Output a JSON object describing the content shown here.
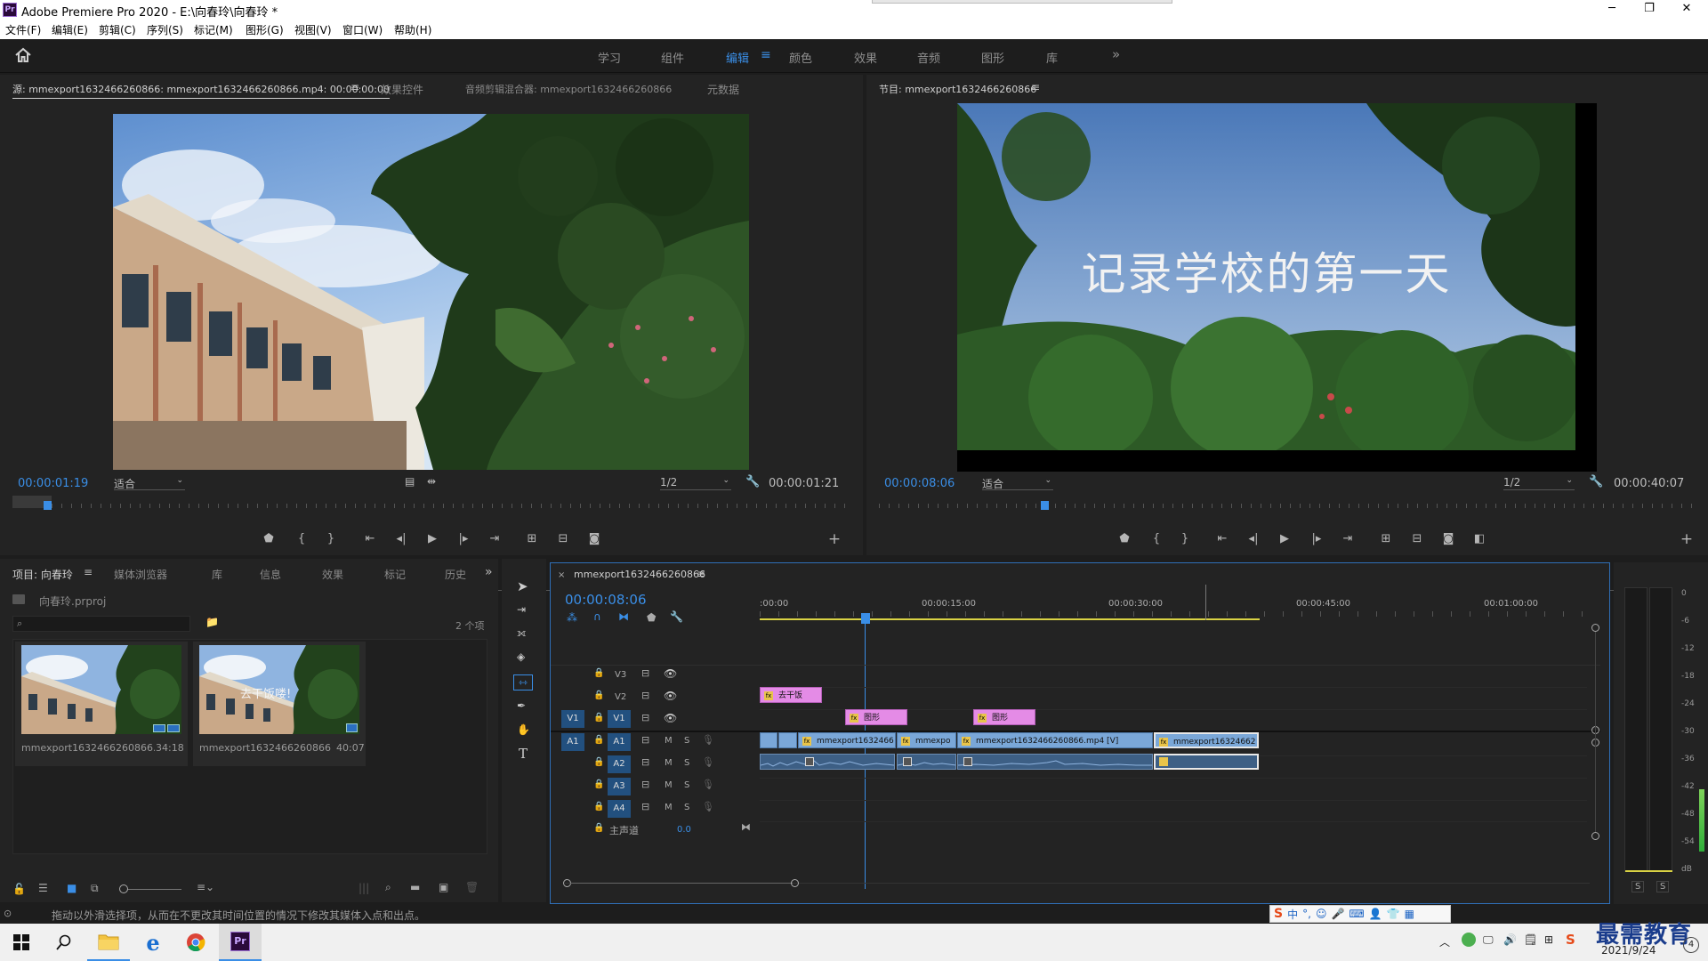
{
  "window": {
    "app_icon": "Pr",
    "title": "Adobe Premiere Pro 2020 - E:\\向春玲\\向春玲 *",
    "controls": [
      "─",
      "❐",
      "✕"
    ]
  },
  "menu": [
    "文件(F)",
    "编辑(E)",
    "剪辑(C)",
    "序列(S)",
    "标记(M)",
    "图形(G)",
    "视图(V)",
    "窗口(W)",
    "帮助(H)"
  ],
  "workspaces": {
    "items": [
      "学习",
      "组件",
      "编辑",
      "颜色",
      "效果",
      "音频",
      "图形",
      "库"
    ],
    "active": "编辑",
    "more": "»"
  },
  "source_monitor": {
    "tabs": [
      "源: mmexport1632466260866: mmexport1632466260866.mp4: 00:00:00:00",
      "效果控件",
      "音频剪辑混合器: mmexport1632466260866",
      "元数据"
    ],
    "timecode": "00:00:01:19",
    "fit": "适合",
    "resolution": "1/2",
    "duration": "00:00:01:21",
    "playhead_fraction": 0.042
  },
  "program_monitor": {
    "tab": "节目: mmexport1632466260866",
    "overlay_text": "记录学校的第一天",
    "timecode": "00:00:08:06",
    "fit": "适合",
    "resolution": "1/2",
    "duration": "00:00:40:07",
    "playhead_fraction": 0.203
  },
  "project_panel": {
    "tabs": [
      "项目: 向春玲",
      "媒体浏览器",
      "库",
      "信息",
      "效果",
      "标记",
      "历史"
    ],
    "file": "向春玲.prproj",
    "count": "2 个项",
    "items": [
      {
        "name": "mmexport1632466260866...",
        "duration": "34:18",
        "overlay": ""
      },
      {
        "name": "mmexport1632466260866",
        "duration": "40:07",
        "overlay": "去干饭喽!"
      }
    ]
  },
  "timeline": {
    "sequence": "mmexport1632466260866",
    "timecode": "00:00:08:06",
    "ruler": [
      ":00:00",
      "00:00:15:00",
      "00:00:30:00",
      "00:00:45:00",
      "00:01:00:00"
    ],
    "video_tracks": [
      "V3",
      "V2",
      "V1"
    ],
    "audio_tracks": [
      "A1",
      "A2",
      "A3",
      "A4"
    ],
    "master_label": "主声道",
    "master_value": "0.0",
    "source_patch_v": "V1",
    "source_patch_a": "A1",
    "mute": "M",
    "solo": "S",
    "clips": {
      "v3": "去干饭",
      "v2a": "图形",
      "v2b": "图形",
      "v1a": "mmexport1632466",
      "v1b": "mmexpo",
      "v1c": "mmexport1632466260866.mp4 [V]",
      "v1d": "mmexport16324662"
    }
  },
  "meter": {
    "scale": [
      "0",
      "-6",
      "-12",
      "-18",
      "-24",
      "-30",
      "-36",
      "-42",
      "-48",
      "-54",
      "dB"
    ],
    "solo_labels": [
      "S",
      "S"
    ]
  },
  "status": {
    "text": "拖动以外滑选择项，从而在不更改其时间位置的情况下修改其媒体入点和出点。"
  },
  "ime": {
    "lang": "中",
    "glyphs": [
      "°,",
      "☺",
      "🎤",
      "⌨",
      "👤",
      "👕",
      "▦"
    ]
  },
  "taskbar": {
    "date": "2021/9/24",
    "watermark": "最需教育"
  }
}
